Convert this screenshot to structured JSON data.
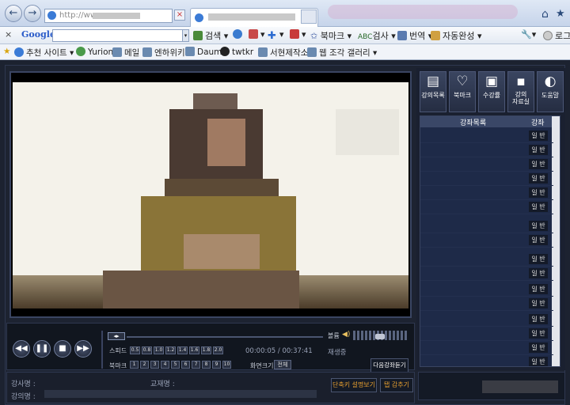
{
  "browser": {
    "back": "←",
    "forward": "→",
    "address_text": "http://www",
    "home_icon": "home-icon",
    "star_icon": "favorites-star-icon"
  },
  "toolbar": {
    "close": "×",
    "google": "Google",
    "search": "검색",
    "bookmark": "북마크",
    "spell": "검사",
    "translate": "번역",
    "autocomplete": "자동완성",
    "login": "로그"
  },
  "favorites": {
    "items": [
      "추천 사이트 ▾",
      "Yurion",
      "메일",
      "엔하위키",
      "Daum",
      "twtkr",
      "서현제작소",
      "웹 조각 갤러리 ▾"
    ]
  },
  "sidebar": {
    "buttons": [
      "강의목록",
      "북마크",
      "수강률",
      "강의\n자료실",
      "도움말"
    ],
    "list_header_title": "강좌목록",
    "list_header_col": "강좌",
    "row_badge": "일 반"
  },
  "player": {
    "speed_label": "스피드",
    "speeds": [
      "0.5",
      "0.8",
      "1.0",
      "1.2",
      "1.4",
      "1.6",
      "1.8",
      "2.0"
    ],
    "bookmark_label": "북마크",
    "bookmarks": [
      "1",
      "2",
      "3",
      "4",
      "5",
      "6",
      "7",
      "8",
      "9",
      "10"
    ],
    "time": "00:00:05 / 00:37:41",
    "status": "재생중",
    "volume_label": "볼륨",
    "screen_size_label": "화면크기",
    "screen_size_value": "전체",
    "next_lecture": "다음강좌듣기",
    "instructor_label": "강사명 :",
    "textbook_label": "교재명 :",
    "lecture_label": "강의명 :",
    "shortcut_button": "단축키 설명보기",
    "hide_button": "탭 감추기",
    "accent": "#e8a030"
  }
}
